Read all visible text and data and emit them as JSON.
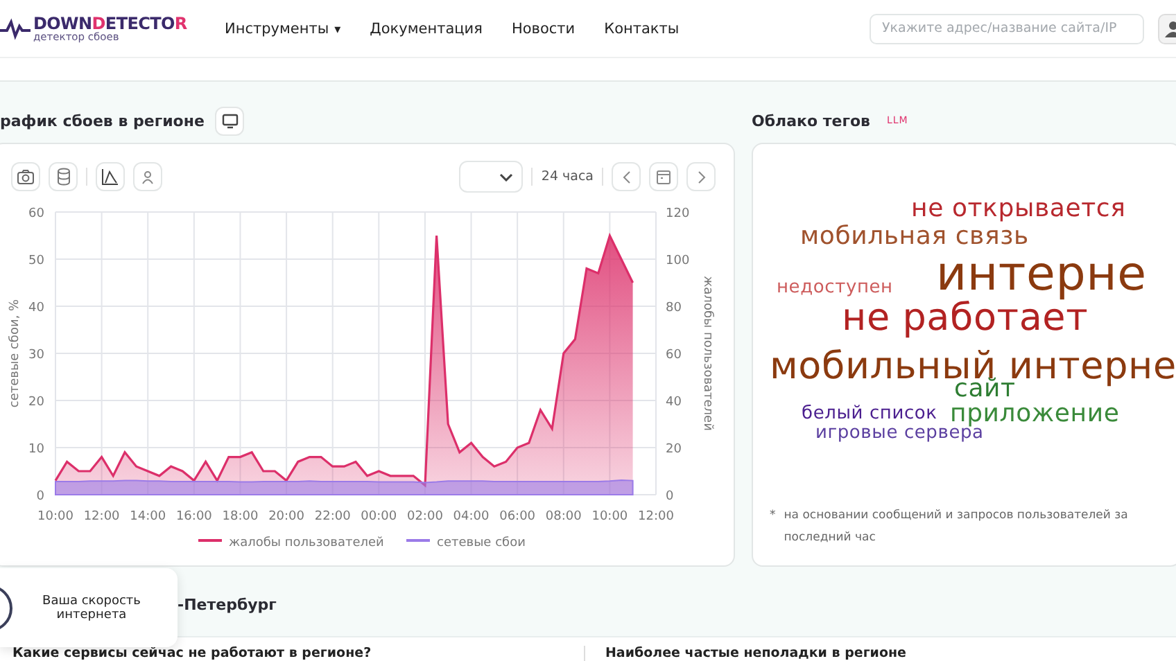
{
  "header": {
    "logo": [
      {
        "text": "DOWN",
        "color": "#3b2a6b"
      },
      {
        "text": "D",
        "color": "#e0336e"
      },
      {
        "text": "ETECTO",
        "color": "#3b2a6b"
      },
      {
        "text": "R",
        "color": "#e0336e"
      }
    ],
    "tagline": "детектор сбоев",
    "nav": [
      {
        "label": "Инструменты",
        "caret": "▾"
      },
      {
        "label": "Документация"
      },
      {
        "label": "Новости"
      },
      {
        "label": "Контакты"
      }
    ],
    "search": {
      "placeholder": "Укажите адрес/название сайта/IP"
    }
  },
  "outage_chart": {
    "title": "рафик сбоев в регионе",
    "period": "24 часа",
    "chart_data": {
      "type": "area",
      "grid": true,
      "legend": "bottom",
      "ylabel": "сетевые сбои, %",
      "y2label": "жалобы пользователей",
      "ylim": [
        0,
        60
      ],
      "y2lim": [
        0,
        120
      ],
      "yticks": [
        0,
        10,
        20,
        30,
        40,
        50,
        60
      ],
      "y2ticks": [
        0,
        20,
        40,
        60,
        80,
        100,
        120
      ],
      "categories": [
        "10:00",
        null,
        null,
        null,
        "12:00",
        null,
        null,
        null,
        "14:00",
        null,
        null,
        null,
        "16:00",
        null,
        null,
        null,
        "18:00",
        null,
        null,
        null,
        "20:00",
        null,
        null,
        null,
        "22:00",
        null,
        null,
        null,
        "00:00",
        null,
        null,
        null,
        "02:00",
        null,
        null,
        null,
        "04:00",
        null,
        null,
        null,
        "06:00",
        null,
        null,
        null,
        "08:00",
        null,
        null,
        null,
        "10:00",
        null,
        null,
        null,
        "12:00"
      ],
      "series": [
        {
          "name": "жалобы пользователей",
          "color": "#dc2f6a",
          "axis": "y2",
          "values": [
            6,
            14,
            10,
            10,
            16,
            8,
            18,
            12,
            10,
            8,
            12,
            10,
            6,
            14,
            6,
            16,
            16,
            18,
            10,
            10,
            6,
            14,
            16,
            16,
            12,
            12,
            14,
            8,
            10,
            8,
            8,
            8,
            4,
            110,
            30,
            18,
            22,
            16,
            12,
            14,
            20,
            22,
            36,
            28,
            60,
            66,
            96,
            94,
            110,
            100,
            90,
            null,
            null
          ]
        },
        {
          "name": "сетевые сбои",
          "color": "#9b7be8",
          "values": [
            2.8,
            2.8,
            2.8,
            2.9,
            2.9,
            2.9,
            3,
            3,
            2.9,
            2.9,
            2.8,
            2.8,
            2.8,
            2.8,
            2.8,
            2.8,
            2.7,
            2.7,
            2.8,
            2.8,
            2.8,
            2.8,
            2.9,
            2.8,
            2.8,
            2.8,
            2.8,
            2.8,
            2.7,
            2.7,
            2.7,
            2.7,
            2.6,
            2.7,
            2.9,
            2.9,
            2.9,
            2.9,
            2.8,
            2.8,
            2.8,
            2.8,
            2.8,
            2.8,
            2.8,
            2.8,
            2.8,
            2.8,
            2.9,
            3.1,
            3,
            null,
            null
          ]
        }
      ]
    }
  },
  "tag_cloud": {
    "title": "Облако тегов",
    "badge": "LLM",
    "tags": [
      {
        "text": "не открывается",
        "kind": "m",
        "color": "#b8282e"
      },
      {
        "text": "мобильная связь",
        "kind": "m",
        "color": "#a0522d"
      },
      {
        "text": "интерне",
        "kind": "xl",
        "color": "#8b3a0f"
      },
      {
        "text": "недоступен",
        "kind": "s",
        "color": "#cd5c5c"
      },
      {
        "text": "не работает",
        "kind": "l",
        "color": "#b22222"
      },
      {
        "text": "мобильный интерне",
        "kind": "l",
        "color": "#8b3a0f"
      },
      {
        "text": "сайт",
        "kind": "m",
        "color": "#2e7d32"
      },
      {
        "text": "белый список",
        "kind": "s",
        "color": "#4b1f8f"
      },
      {
        "text": "приложение",
        "kind": "m",
        "color": "#3a8a3a"
      },
      {
        "text": "игровые сервера",
        "kind": "s",
        "color": "#5b3fa0"
      }
    ],
    "footnote_mark": "*",
    "footnote": "на основании сообщений и запросов пользователей за последний час"
  },
  "region_title": "-Петербург",
  "speed_popup": {
    "label": "Ваша скорость интернета"
  },
  "sections": [
    "Какие сервисы сейчас не работают в регионе?",
    "Наиболее частые неполадки в регионе"
  ]
}
